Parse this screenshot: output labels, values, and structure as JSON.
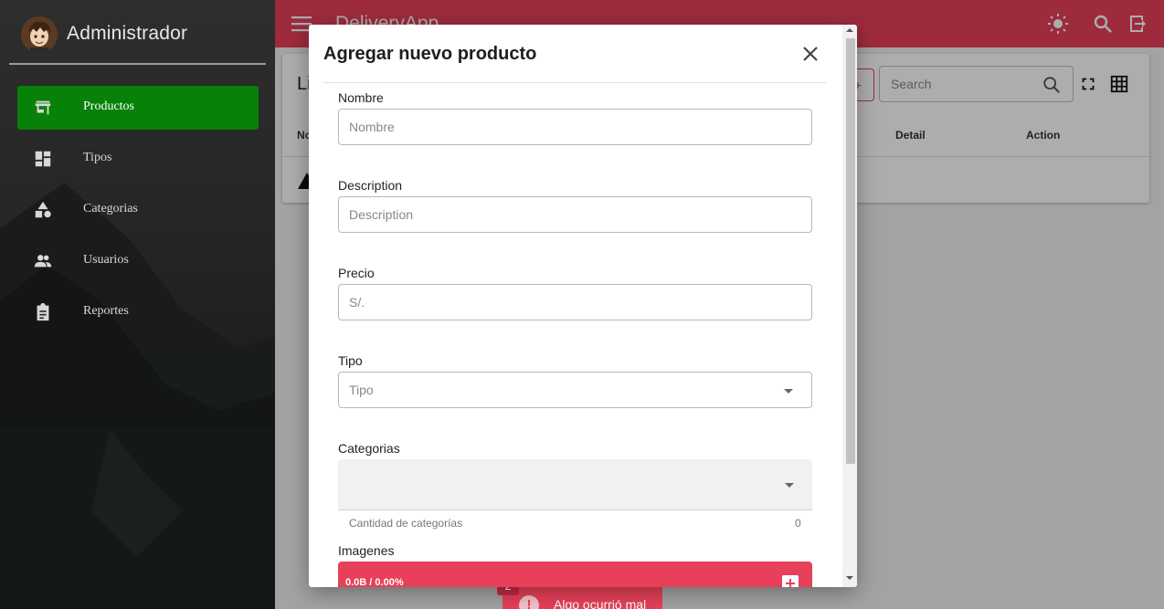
{
  "sidebar": {
    "user_title": "Administrador",
    "items": [
      {
        "label": "Productos",
        "icon": "store-icon",
        "active": true
      },
      {
        "label": "Tipos",
        "icon": "dashboard-icon",
        "active": false
      },
      {
        "label": "Categorias",
        "icon": "category-icon",
        "active": false
      },
      {
        "label": "Usuarios",
        "icon": "people-icon",
        "active": false
      },
      {
        "label": "Reportes",
        "icon": "clipboard-icon",
        "active": false
      }
    ]
  },
  "topbar": {
    "title": "DeliveryApp",
    "icons": [
      "menu-icon",
      "brightness-icon",
      "search-icon",
      "logout-icon"
    ]
  },
  "card": {
    "title": "Li",
    "search_placeholder": "Search",
    "columns": [
      "No",
      "Detail",
      "Action"
    ]
  },
  "modal": {
    "title": "Agregar nuevo producto",
    "fields": {
      "nombre": {
        "label": "Nombre",
        "placeholder": "Nombre"
      },
      "description": {
        "label": "Description",
        "placeholder": "Description"
      },
      "precio": {
        "label": "Precio",
        "placeholder": "S/."
      },
      "tipo": {
        "label": "Tipo",
        "placeholder": "Tipo"
      },
      "categorias": {
        "label": "Categorias",
        "hint": "Cantidad de categorías",
        "count": "0"
      },
      "imagenes": {
        "label": "Imagenes",
        "upload_status": "0.0B / 0.00%"
      }
    }
  },
  "toast": {
    "badge": "2",
    "message": "Algo ocurrió mal"
  },
  "colors": {
    "accent": "#e8405a",
    "active_nav": "#078107"
  }
}
